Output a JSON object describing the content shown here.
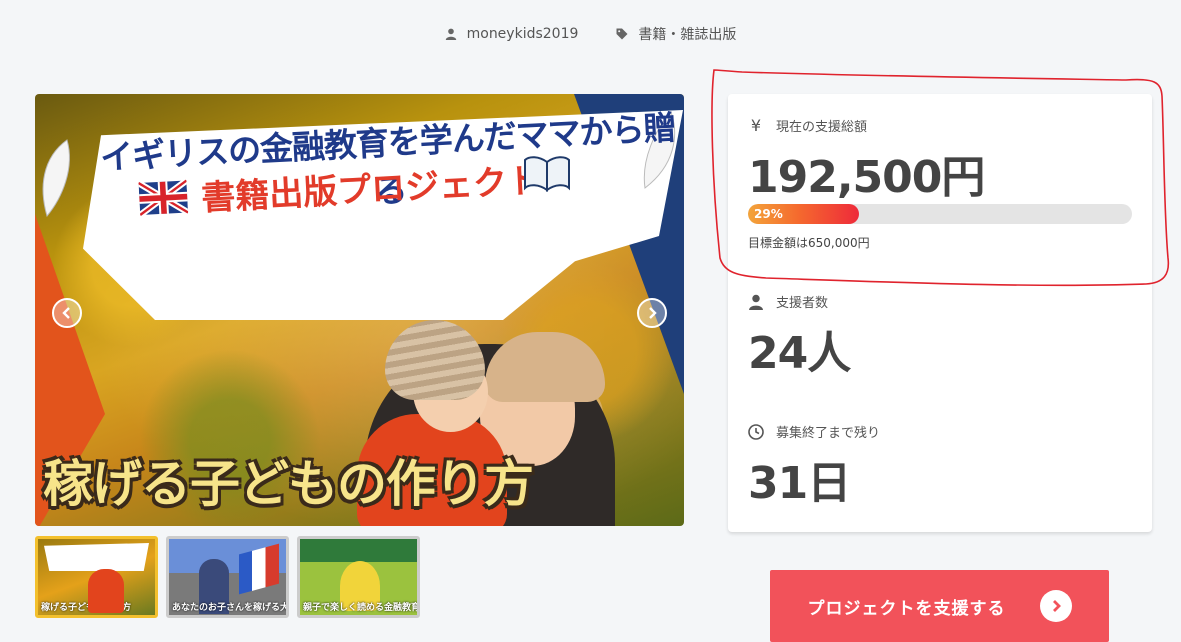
{
  "meta": {
    "author": "moneykids2019",
    "category": "書籍・雑誌出版"
  },
  "slider": {
    "banner_title": "イギリスの金融教育を学んだママから贈る",
    "banner_subtitle": "書籍出版プロジェクト",
    "caption": "稼げる子どもの作り方",
    "thumbnails": [
      {
        "text": "稼げる子どもの作り方",
        "active": true
      },
      {
        "text": "あなたのお子さんを稼げる大人に",
        "active": false
      },
      {
        "text": "親子で楽しく読める金融教育の本",
        "active": false
      }
    ]
  },
  "stats": {
    "amount_label": "現在の支援総額",
    "amount_value": "192,500円",
    "progress_percent_label": "29%",
    "progress_fraction": 0.29,
    "goal_text": "目標金額は650,000円",
    "backers_label": "支援者数",
    "backers_value": "24人",
    "remaining_label": "募集終了まで残り",
    "remaining_value": "31日",
    "yen_symbol": "¥"
  },
  "cta": {
    "label": "プロジェクトを支援する"
  },
  "colors": {
    "accent": "#f2525a",
    "annotation": "#e0232d",
    "progress_start": "#f3a43a",
    "progress_end": "#ee2a3a"
  },
  "icons": {
    "author": "user-icon",
    "category": "tag-icon",
    "amount": "yen-icon",
    "backers": "user-icon",
    "remaining": "clock-icon",
    "prev": "chevron-left-icon",
    "next": "chevron-right-icon",
    "cta": "chevron-right-circle-icon"
  }
}
